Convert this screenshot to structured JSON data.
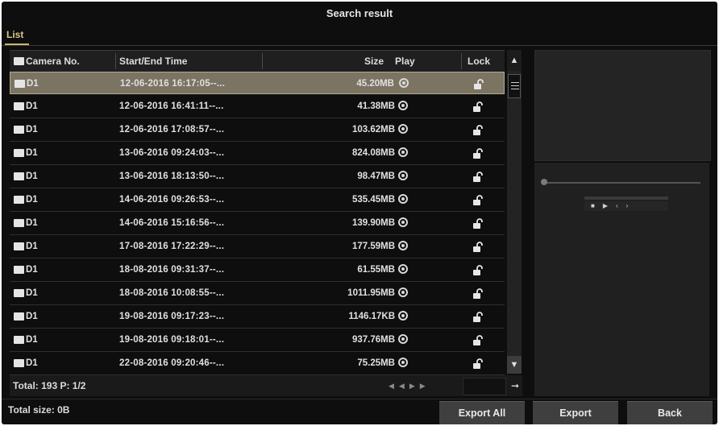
{
  "window": {
    "title": "Search result"
  },
  "tabs": [
    {
      "label": "List",
      "active": true
    }
  ],
  "table": {
    "headers": {
      "camera": "Camera No.",
      "time": "Start/End Time",
      "size": "Size",
      "play": "Play",
      "lock": "Lock"
    },
    "rows": [
      {
        "camera": "D1",
        "time": "12-06-2016 16:17:05--...",
        "size": "45.20MB",
        "selected": true
      },
      {
        "camera": "D1",
        "time": "12-06-2016 16:41:11--...",
        "size": "41.38MB"
      },
      {
        "camera": "D1",
        "time": "12-06-2016 17:08:57--...",
        "size": "103.62MB"
      },
      {
        "camera": "D1",
        "time": "13-06-2016 09:24:03--...",
        "size": "824.08MB"
      },
      {
        "camera": "D1",
        "time": "13-06-2016 18:13:50--...",
        "size": "98.47MB"
      },
      {
        "camera": "D1",
        "time": "14-06-2016 09:26:53--...",
        "size": "535.45MB"
      },
      {
        "camera": "D1",
        "time": "14-06-2016 15:16:56--...",
        "size": "139.90MB"
      },
      {
        "camera": "D1",
        "time": "17-08-2016 17:22:29--...",
        "size": "177.59MB"
      },
      {
        "camera": "D1",
        "time": "18-08-2016 09:31:37--...",
        "size": "61.55MB"
      },
      {
        "camera": "D1",
        "time": "18-08-2016 10:08:55--...",
        "size": "1011.95MB"
      },
      {
        "camera": "D1",
        "time": "19-08-2016 09:17:23--...",
        "size": "1146.17KB"
      },
      {
        "camera": "D1",
        "time": "19-08-2016 09:18:01--...",
        "size": "937.76MB"
      },
      {
        "camera": "D1",
        "time": "22-08-2016 09:20:46--...",
        "size": "75.25MB"
      }
    ]
  },
  "footer": {
    "total": "Total: 193  P: 1/2",
    "total_size": "Total size: 0B"
  },
  "buttons": {
    "export_all": "Export All",
    "export": "Export",
    "back": "Back"
  },
  "icons": {
    "play": "play-circle-icon",
    "lock": "unlocked-padlock-icon",
    "scroll_up": "chevron-up-icon",
    "scroll_down": "chevron-down-icon",
    "go": "arrow-right-icon"
  },
  "colors": {
    "background": "#0e0e0e",
    "selected_row": "#7b7463",
    "tab_accent": "#c8b56a"
  }
}
